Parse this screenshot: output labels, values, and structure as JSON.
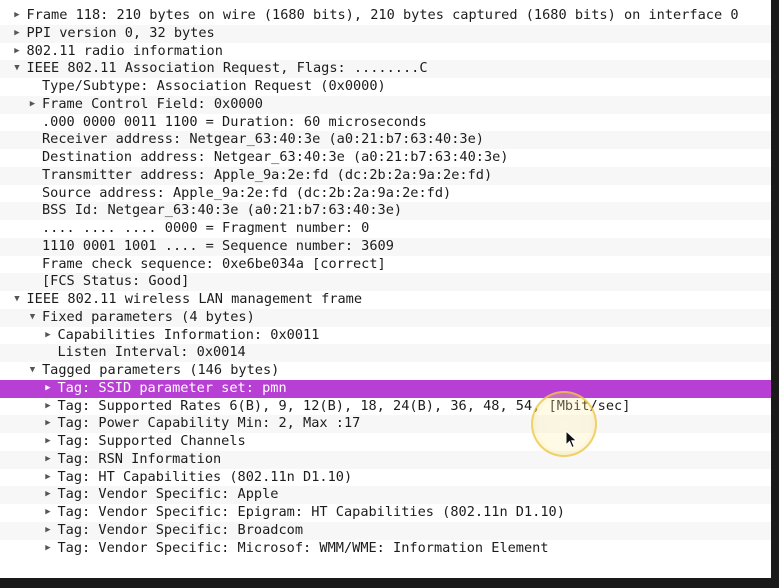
{
  "tree": [
    {
      "text": "Frame 118: 210 bytes on wire (1680 bits), 210 bytes captured (1680 bits) on interface 0",
      "level": 0,
      "toggle": "collapsed"
    },
    {
      "text": "PPI version 0, 32 bytes",
      "level": 0,
      "toggle": "collapsed"
    },
    {
      "text": "802.11 radio information",
      "level": 0,
      "toggle": "collapsed"
    },
    {
      "text": "IEEE 802.11 Association Request, Flags: ........C",
      "level": 0,
      "toggle": "expanded"
    },
    {
      "text": "Type/Subtype: Association Request (0x0000)",
      "level": 1,
      "toggle": "none"
    },
    {
      "text": "Frame Control Field: 0x0000",
      "level": 1,
      "toggle": "collapsed"
    },
    {
      "text": ".000 0000 0011 1100 = Duration: 60 microseconds",
      "level": 1,
      "toggle": "none"
    },
    {
      "text": "Receiver address: Netgear_63:40:3e (a0:21:b7:63:40:3e)",
      "level": 1,
      "toggle": "none"
    },
    {
      "text": "Destination address: Netgear_63:40:3e (a0:21:b7:63:40:3e)",
      "level": 1,
      "toggle": "none"
    },
    {
      "text": "Transmitter address: Apple_9a:2e:fd (dc:2b:2a:9a:2e:fd)",
      "level": 1,
      "toggle": "none"
    },
    {
      "text": "Source address: Apple_9a:2e:fd (dc:2b:2a:9a:2e:fd)",
      "level": 1,
      "toggle": "none"
    },
    {
      "text": "BSS Id: Netgear_63:40:3e (a0:21:b7:63:40:3e)",
      "level": 1,
      "toggle": "none"
    },
    {
      "text": ".... .... .... 0000 = Fragment number: 0",
      "level": 1,
      "toggle": "none"
    },
    {
      "text": "1110 0001 1001 .... = Sequence number: 3609",
      "level": 1,
      "toggle": "none"
    },
    {
      "text": "Frame check sequence: 0xe6be034a [correct]",
      "level": 1,
      "toggle": "none"
    },
    {
      "text": "[FCS Status: Good]",
      "level": 1,
      "toggle": "none"
    },
    {
      "text": "IEEE 802.11 wireless LAN management frame",
      "level": 0,
      "toggle": "expanded"
    },
    {
      "text": "Fixed parameters (4 bytes)",
      "level": 1,
      "toggle": "expanded"
    },
    {
      "text": "Capabilities Information: 0x0011",
      "level": 2,
      "toggle": "collapsed"
    },
    {
      "text": "Listen Interval: 0x0014",
      "level": 2,
      "toggle": "none"
    },
    {
      "text": "Tagged parameters (146 bytes)",
      "level": 1,
      "toggle": "expanded"
    },
    {
      "text": "Tag: SSID parameter set: pmn",
      "level": 2,
      "toggle": "collapsed",
      "selected": true
    },
    {
      "text": "Tag: Supported Rates 6(B), 9, 12(B), 18, 24(B), 36, 48, 54, [Mbit/sec]",
      "level": 2,
      "toggle": "collapsed"
    },
    {
      "text": "Tag: Power Capability Min: 2, Max :17",
      "level": 2,
      "toggle": "collapsed"
    },
    {
      "text": "Tag: Supported Channels",
      "level": 2,
      "toggle": "collapsed"
    },
    {
      "text": "Tag: RSN Information",
      "level": 2,
      "toggle": "collapsed"
    },
    {
      "text": "Tag: HT Capabilities (802.11n D1.10)",
      "level": 2,
      "toggle": "collapsed"
    },
    {
      "text": "Tag: Vendor Specific: Apple",
      "level": 2,
      "toggle": "collapsed"
    },
    {
      "text": "Tag: Vendor Specific: Epigram: HT Capabilities (802.11n D1.10)",
      "level": 2,
      "toggle": "collapsed"
    },
    {
      "text": "Tag: Vendor Specific: Broadcom",
      "level": 2,
      "toggle": "collapsed"
    },
    {
      "text": "Tag: Vendor Specific: Microsof: WMM/WME: Information Element",
      "level": 2,
      "toggle": "collapsed"
    }
  ],
  "colors": {
    "selection": "#b73fd3",
    "text": "#1c1c1c",
    "selected_text": "#ffffff",
    "cursor_halo": "#ecc446"
  },
  "icons": {
    "collapsed": "triangle-right-icon",
    "expanded": "triangle-down-icon",
    "cursor": "mouse-pointer-icon"
  }
}
